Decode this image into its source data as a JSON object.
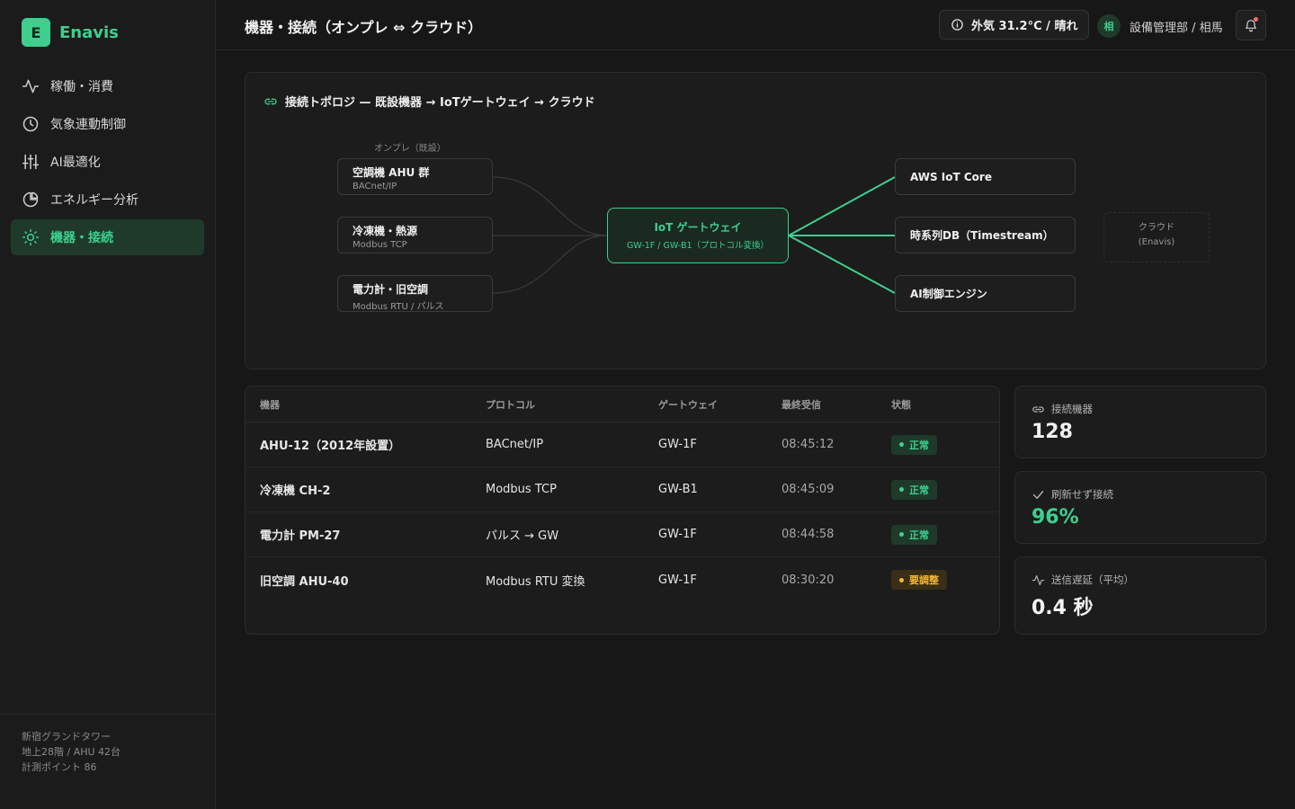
{
  "brand": {
    "logo": "E",
    "name": "Enavis"
  },
  "sidebar": {
    "items": [
      {
        "label": "稼働・消費",
        "icon": "activity-icon"
      },
      {
        "label": "気象連動制御",
        "icon": "clock-icon"
      },
      {
        "label": "AI最適化",
        "icon": "sliders-icon"
      },
      {
        "label": "エネルギー分析",
        "icon": "pie-chart-icon"
      },
      {
        "label": "機器・接続",
        "icon": "sun-icon",
        "active": true
      }
    ],
    "footer": {
      "line1": "新宿グランドタワー",
      "line2": "地上28階 / AHU 42台",
      "line3": "計測ポイント 86"
    }
  },
  "header": {
    "title": "機器・接続（オンプレ ⇔ クラウド）",
    "weather": "外気 31.2°C / 晴れ",
    "avatar": "相",
    "user": "設備管理部 / 相馬"
  },
  "topology": {
    "title": "接続トポロジ — 既設機器 → IoTゲートウェイ → クラウド",
    "onprem_label": "オンプレ（既設）",
    "onprem": [
      {
        "title": "空調機 AHU 群",
        "sub": "BACnet/IP"
      },
      {
        "title": "冷凍機・熱源",
        "sub": "Modbus TCP"
      },
      {
        "title": "電力計・旧空調",
        "sub": "Modbus RTU / パルス"
      }
    ],
    "gateway": {
      "title": "IoT ゲートウェイ",
      "sub": "GW-1F / GW-B1（プロトコル変換）"
    },
    "cloud": [
      {
        "title": "AWS IoT Core"
      },
      {
        "title": "時系列DB（Timestream）"
      },
      {
        "title": "AI制御エンジン"
      }
    ],
    "cloud_label_1": "クラウド",
    "cloud_label_2": "(Enavis)"
  },
  "table": {
    "headers": {
      "device": "機器",
      "protocol": "プロトコル",
      "gateway": "ゲートウェイ",
      "last": "最終受信",
      "status": "状態"
    },
    "rows": [
      {
        "device": "AHU-12（2012年設置）",
        "protocol": "BACnet/IP",
        "gateway": "GW-1F",
        "last": "08:45:12",
        "status": "正常",
        "level": "ok"
      },
      {
        "device": "冷凍機 CH-2",
        "protocol": "Modbus TCP",
        "gateway": "GW-B1",
        "last": "08:45:09",
        "status": "正常",
        "level": "ok"
      },
      {
        "device": "電力計 PM-27",
        "protocol": "パルス → GW",
        "gateway": "GW-1F",
        "last": "08:44:58",
        "status": "正常",
        "level": "ok"
      },
      {
        "device": "旧空調 AHU-40",
        "protocol": "Modbus RTU 変換",
        "gateway": "GW-1F",
        "last": "08:30:20",
        "status": "要調整",
        "level": "warn"
      }
    ]
  },
  "stats": {
    "connected": {
      "label": "接続機器",
      "value": "128"
    },
    "no_retrofit": {
      "label": "刷新せず接続",
      "value": "96%"
    },
    "latency": {
      "label": "送信遅延（平均）",
      "value": "0.4 秒"
    }
  },
  "colors": {
    "accent": "#3ecf8e",
    "warn": "#f5b731",
    "background": "#171717"
  }
}
